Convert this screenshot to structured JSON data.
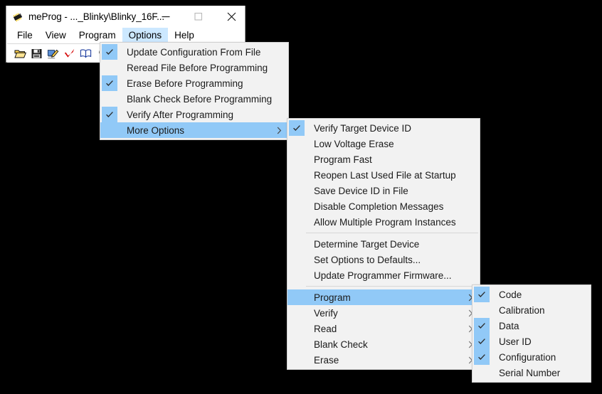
{
  "window": {
    "title": "meProg - ..._Blinky\\Blinky_16F...",
    "icon": "chip-icon",
    "controls": {
      "minimize": "—",
      "maximize": "□",
      "close": "✕"
    }
  },
  "menubar": {
    "items": [
      {
        "label": "File",
        "active": false
      },
      {
        "label": "View",
        "active": false
      },
      {
        "label": "Program",
        "active": false
      },
      {
        "label": "Options",
        "active": true
      },
      {
        "label": "Help",
        "active": false
      }
    ]
  },
  "toolbar": {
    "buttons": [
      {
        "icon": "open-folder-icon",
        "title": "Open"
      },
      {
        "icon": "save-floppy-icon",
        "title": "Save"
      },
      {
        "icon": "program-device-icon",
        "title": "Program"
      },
      {
        "icon": "verify-check-icon",
        "title": "Verify"
      },
      {
        "icon": "read-book-icon",
        "title": "Read"
      },
      {
        "icon": "blank-check-bulb-icon",
        "title": "Blank Check"
      }
    ]
  },
  "menu_options": {
    "items": [
      {
        "label": "Update Configuration From File",
        "checked": true,
        "selected": false,
        "submenu": false
      },
      {
        "label": "Reread File Before Programming",
        "checked": false,
        "selected": false,
        "submenu": false
      },
      {
        "label": "Erase Before Programming",
        "checked": true,
        "selected": false,
        "submenu": false
      },
      {
        "label": "Blank Check Before Programming",
        "checked": false,
        "selected": false,
        "submenu": false
      },
      {
        "label": "Verify After Programming",
        "checked": true,
        "selected": false,
        "submenu": false
      },
      {
        "label": "More Options",
        "checked": false,
        "selected": true,
        "submenu": true
      }
    ]
  },
  "menu_more_options": {
    "items": [
      {
        "type": "item",
        "label": "Verify Target Device ID",
        "checked": true,
        "selected": false,
        "submenu": false
      },
      {
        "type": "item",
        "label": "Low Voltage Erase",
        "checked": false,
        "selected": false,
        "submenu": false
      },
      {
        "type": "item",
        "label": "Program Fast",
        "checked": false,
        "selected": false,
        "submenu": false
      },
      {
        "type": "item",
        "label": "Reopen Last Used File at Startup",
        "checked": false,
        "selected": false,
        "submenu": false
      },
      {
        "type": "item",
        "label": "Save Device ID in File",
        "checked": false,
        "selected": false,
        "submenu": false
      },
      {
        "type": "item",
        "label": "Disable Completion Messages",
        "checked": false,
        "selected": false,
        "submenu": false
      },
      {
        "type": "item",
        "label": "Allow Multiple Program Instances",
        "checked": false,
        "selected": false,
        "submenu": false
      },
      {
        "type": "separator"
      },
      {
        "type": "item",
        "label": "Determine Target Device",
        "checked": false,
        "selected": false,
        "submenu": false
      },
      {
        "type": "item",
        "label": "Set Options to Defaults...",
        "checked": false,
        "selected": false,
        "submenu": false
      },
      {
        "type": "item",
        "label": "Update Programmer Firmware...",
        "checked": false,
        "selected": false,
        "submenu": false
      },
      {
        "type": "separator"
      },
      {
        "type": "item",
        "label": "Program",
        "checked": false,
        "selected": true,
        "submenu": true
      },
      {
        "type": "item",
        "label": "Verify",
        "checked": false,
        "selected": false,
        "submenu": true
      },
      {
        "type": "item",
        "label": "Read",
        "checked": false,
        "selected": false,
        "submenu": true
      },
      {
        "type": "item",
        "label": "Blank Check",
        "checked": false,
        "selected": false,
        "submenu": true
      },
      {
        "type": "item",
        "label": "Erase",
        "checked": false,
        "selected": false,
        "submenu": true
      }
    ]
  },
  "menu_program": {
    "items": [
      {
        "label": "Code",
        "checked": true,
        "selected": false
      },
      {
        "label": "Calibration",
        "checked": false,
        "selected": false
      },
      {
        "label": "Data",
        "checked": true,
        "selected": false
      },
      {
        "label": "User ID",
        "checked": true,
        "selected": false
      },
      {
        "label": "Configuration",
        "checked": true,
        "selected": false
      },
      {
        "label": "Serial Number",
        "checked": false,
        "selected": false
      }
    ]
  },
  "colors": {
    "menu_bg": "#f2f2f2",
    "highlight": "#91c9f7",
    "menubar_highlight": "#cce8ff",
    "desktop": "#000000",
    "window_bg": "#ffffff",
    "text": "#1a1a1a"
  }
}
